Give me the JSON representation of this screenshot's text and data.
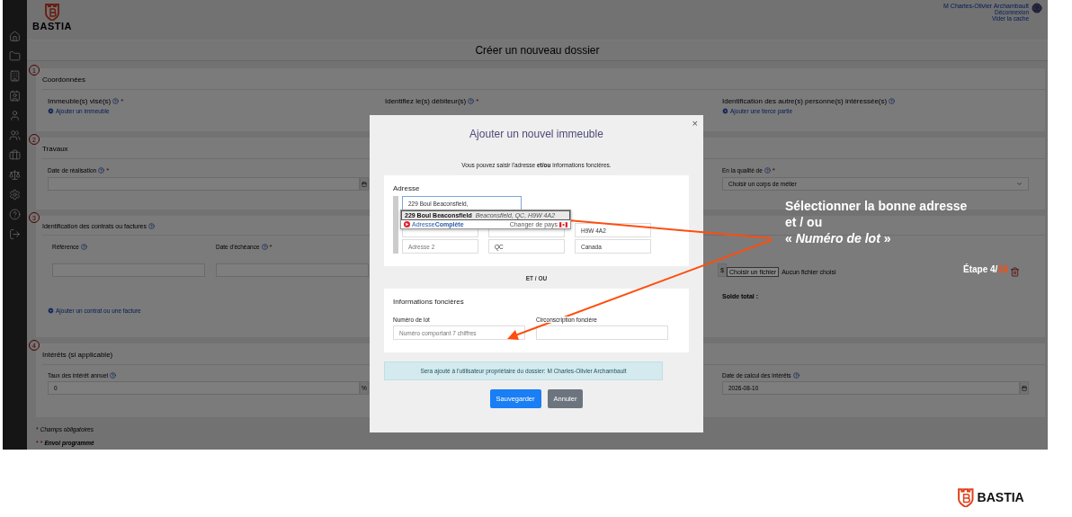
{
  "header": {
    "logo": "BASTIA",
    "user": {
      "name": "M Charles-Olivier Archambault",
      "links": [
        "Déconnexion",
        "Vider la cache"
      ]
    }
  },
  "page_title": "Créer un nouveau dossier",
  "sections": [
    {
      "kind": "parties",
      "number": "1",
      "title": "Coordonnées",
      "columns": [
        {
          "label": "Immeuble(s) visé(s)",
          "required_mark": "*",
          "link": "Ajouter un immeuble"
        },
        {
          "label": "Identifiez le(s) débiteur(s)",
          "required_mark": "*"
        },
        {
          "label": "Identification des autre(s) personne(s) intéressée(s)",
          "link": "Ajouter une tierce partie"
        }
      ]
    },
    {
      "kind": "works",
      "number": "2",
      "title": "Travaux",
      "date_label": "Date de réalisation",
      "date_required_mark": "*",
      "select_label": "En la qualité de",
      "select_required_mark": "*",
      "select_value": "Choisir un corps de métier"
    },
    {
      "kind": "contracts",
      "number": "3",
      "title": "Identification des contrats ou factures",
      "columns": [
        {
          "label": "Référence"
        },
        {
          "label": "Date d'échéance",
          "required_mark": "*"
        }
      ],
      "currency": "$",
      "file_button": "Choisir un fichier",
      "file_status": "Aucun fichier choisi",
      "total_label": "Solde total :",
      "link": "Ajouter un contrat ou une facture"
    },
    {
      "kind": "interests",
      "number": "4",
      "title": "Intérêts (si applicable)",
      "rate_label": "Taux des intérêt annuel",
      "rate_value": "0",
      "rate_unit": "%",
      "date_label": "Date de calcul des intérêts",
      "date_value": "2026-08-10"
    }
  ],
  "footnotes": [
    {
      "marker": "*",
      "text": "Champs obligatoires",
      "bold": false
    },
    {
      "marker": "* *",
      "text": "Envoi programmé",
      "bold": true
    }
  ],
  "modal": {
    "title": "Ajouter un nouvel immeuble",
    "close": "×",
    "intro": "Vous pouvez saisir l'adresse **et/ou** informations foncières.",
    "address": {
      "title": "Adresse",
      "search_value": "229 Boul Beaconsfield,",
      "suggestions": [
        {
          "main": "229 Boul Beaconsfield",
          "detail": "Beaconsfield, QC, H9W 4A2",
          "selected": true
        }
      ],
      "provider": {
        "light": "Adresse",
        "bold": "Complète",
        "change": "Changer de pays"
      },
      "fields": [
        {
          "value": "H9W 4A2"
        },
        {
          "placeholder": "Adresse 2"
        },
        {
          "value": "QC"
        },
        {
          "value": "Canada"
        }
      ]
    },
    "separator": "ET / OU",
    "land": {
      "title": "Informations foncières",
      "lot_label": "Numéro de lot",
      "lot_placeholder": "Numéro comportant 7 chiffres",
      "district_label": "Circonscription foncière"
    },
    "notice": "Sera ajouté à l'utilisateur propriétaire du dossier: M Charles-Olivier Archambault",
    "buttons": [
      {
        "label": "Sauvegarder",
        "kind": "primary"
      },
      {
        "label": "Annuler",
        "kind": "secondary"
      }
    ]
  },
  "annotation": {
    "lines": [
      "Sélectionner la bonne adresse",
      "et / ou",
      "« *Numéro de lot* »"
    ],
    "step": {
      "text": "Étape 4/",
      "total": "18"
    }
  },
  "footer_logo": "BASTIA"
}
